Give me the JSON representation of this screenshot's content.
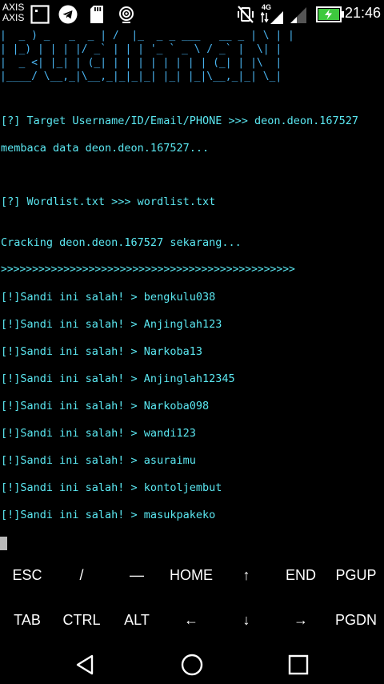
{
  "status_bar": {
    "carrier_1": "AXIS",
    "carrier_2": "AXIS",
    "network_type": "4G",
    "time": "21:46",
    "icons": [
      "notification-square-icon",
      "telegram-icon",
      "sd-card-icon",
      "location-ring-icon",
      "vibrate-off-icon",
      "signal-icon",
      "signal-weak-icon",
      "battery-charging-icon"
    ],
    "battery_color": "#3ec93e"
  },
  "terminal": {
    "banner_lines": [
      "|  _ ) _   _  _ | /  |_  _ _ ___   __ _ | \\ | |",
      "| |_) | | | |/ _` | | | '_ ` _ \\ / _` |  \\| |",
      "|  _ <| |_| | (_| | | | | | | | | (_| | |\\  |",
      "|____/ \\__,_|\\__,_|_|_|_| |_| |_|\\__,_|_| \\_|"
    ],
    "lines": [
      "[?] Target Username/ID/Email/PHONE >>> deon.deon.167527",
      "membaca data deon.deon.167527...",
      "[?] Wordlist.txt >>> wordlist.txt",
      "Cracking deon.deon.167527 sekarang...",
      ">>>>>>>>>>>>>>>>>>>>>>>>>>>>>>>>>>>>>>>>>>>>>>>",
      "[!]Sandi ini salah! > bengkulu038",
      "[!]Sandi ini salah! > Anjinglah123",
      "[!]Sandi ini salah! > Narkoba13",
      "[!]Sandi ini salah! > Anjinglah12345",
      "[!]Sandi ini salah! > Narkoba098",
      "[!]Sandi ini salah! > wandi123",
      "[!]Sandi ini salah! > asuraimu",
      "[!]Sandi ini salah! > kontoljembut",
      "[!]Sandi ini salah! > masukpakeko"
    ],
    "text_color": "#5be8f2",
    "banner_color": "#4bb8f5"
  },
  "extra_keys": {
    "row1": [
      "ESC",
      "/",
      "—",
      "HOME",
      "↑",
      "END",
      "PGUP"
    ],
    "row2": [
      "TAB",
      "CTRL",
      "ALT",
      "←",
      "↓",
      "→",
      "PGDN"
    ]
  },
  "nav_bar": {
    "icons": [
      "back-icon",
      "home-icon",
      "recents-icon"
    ]
  }
}
